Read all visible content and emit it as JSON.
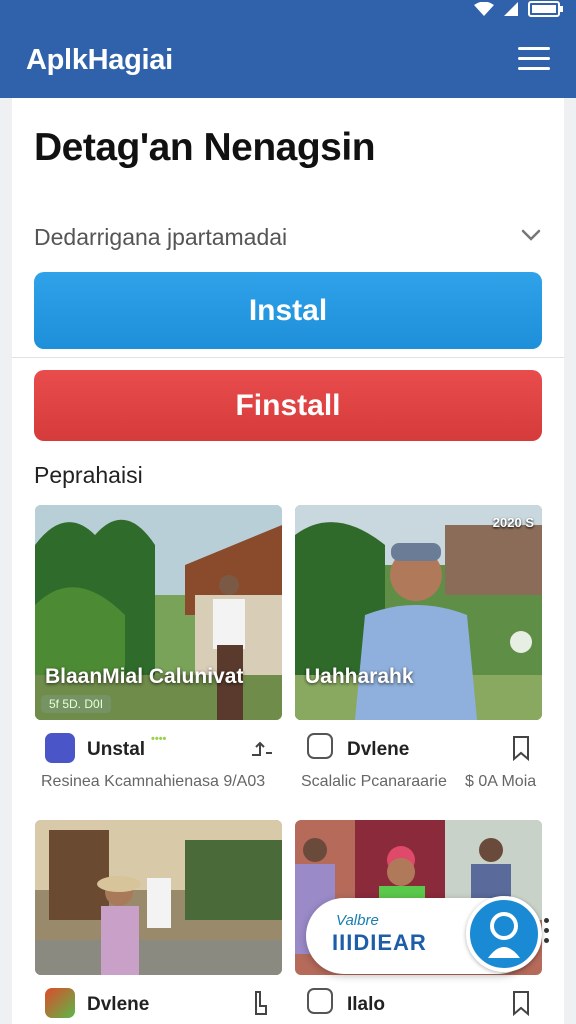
{
  "appbar": {
    "title": "AplkHagiai",
    "menu_icon": "hamburger-menu-icon"
  },
  "page": {
    "title": "Detag'an Nenagsin"
  },
  "dropdown": {
    "label": "Dedarrigana jpartamadai",
    "icon": "chevron-down-icon"
  },
  "buttons": {
    "primary": "Instal",
    "secondary": "Finstall"
  },
  "section": {
    "label": "Peprahaisi"
  },
  "cards": [
    {
      "thumb_title": "BlaanMial Calunivat",
      "thumb_chip": "5f 5D. D0I",
      "icon_color": "#4a55c8",
      "name": "Unstal",
      "badge": "••••",
      "action_icon": "gesture-icon",
      "subtitle": "Resinea Kcamnahienasa 9/A03"
    },
    {
      "thumb_title": "Uahharahk",
      "thumb_date": "2020 S",
      "icon_color": "#ffffff",
      "name": "Dvlene",
      "action_icon": "bookmark-icon",
      "subtitle_left": "Scalalic Pcanaraarie",
      "subtitle_right": "$ 0A Moia"
    },
    {
      "icon_color": "#e05a2b",
      "name": "Dvlene",
      "action_icon": "hand-pointer-icon"
    },
    {
      "icon_color": "#ffffff",
      "name": "Ilalo",
      "action_icon": "bookmark-icon"
    }
  ],
  "banner": {
    "line1": "Valbre",
    "line2": "IIIDIEAR"
  },
  "colors": {
    "appbar": "#2f62ab",
    "primary_button": "#2196e6",
    "secondary_button": "#e04545"
  }
}
